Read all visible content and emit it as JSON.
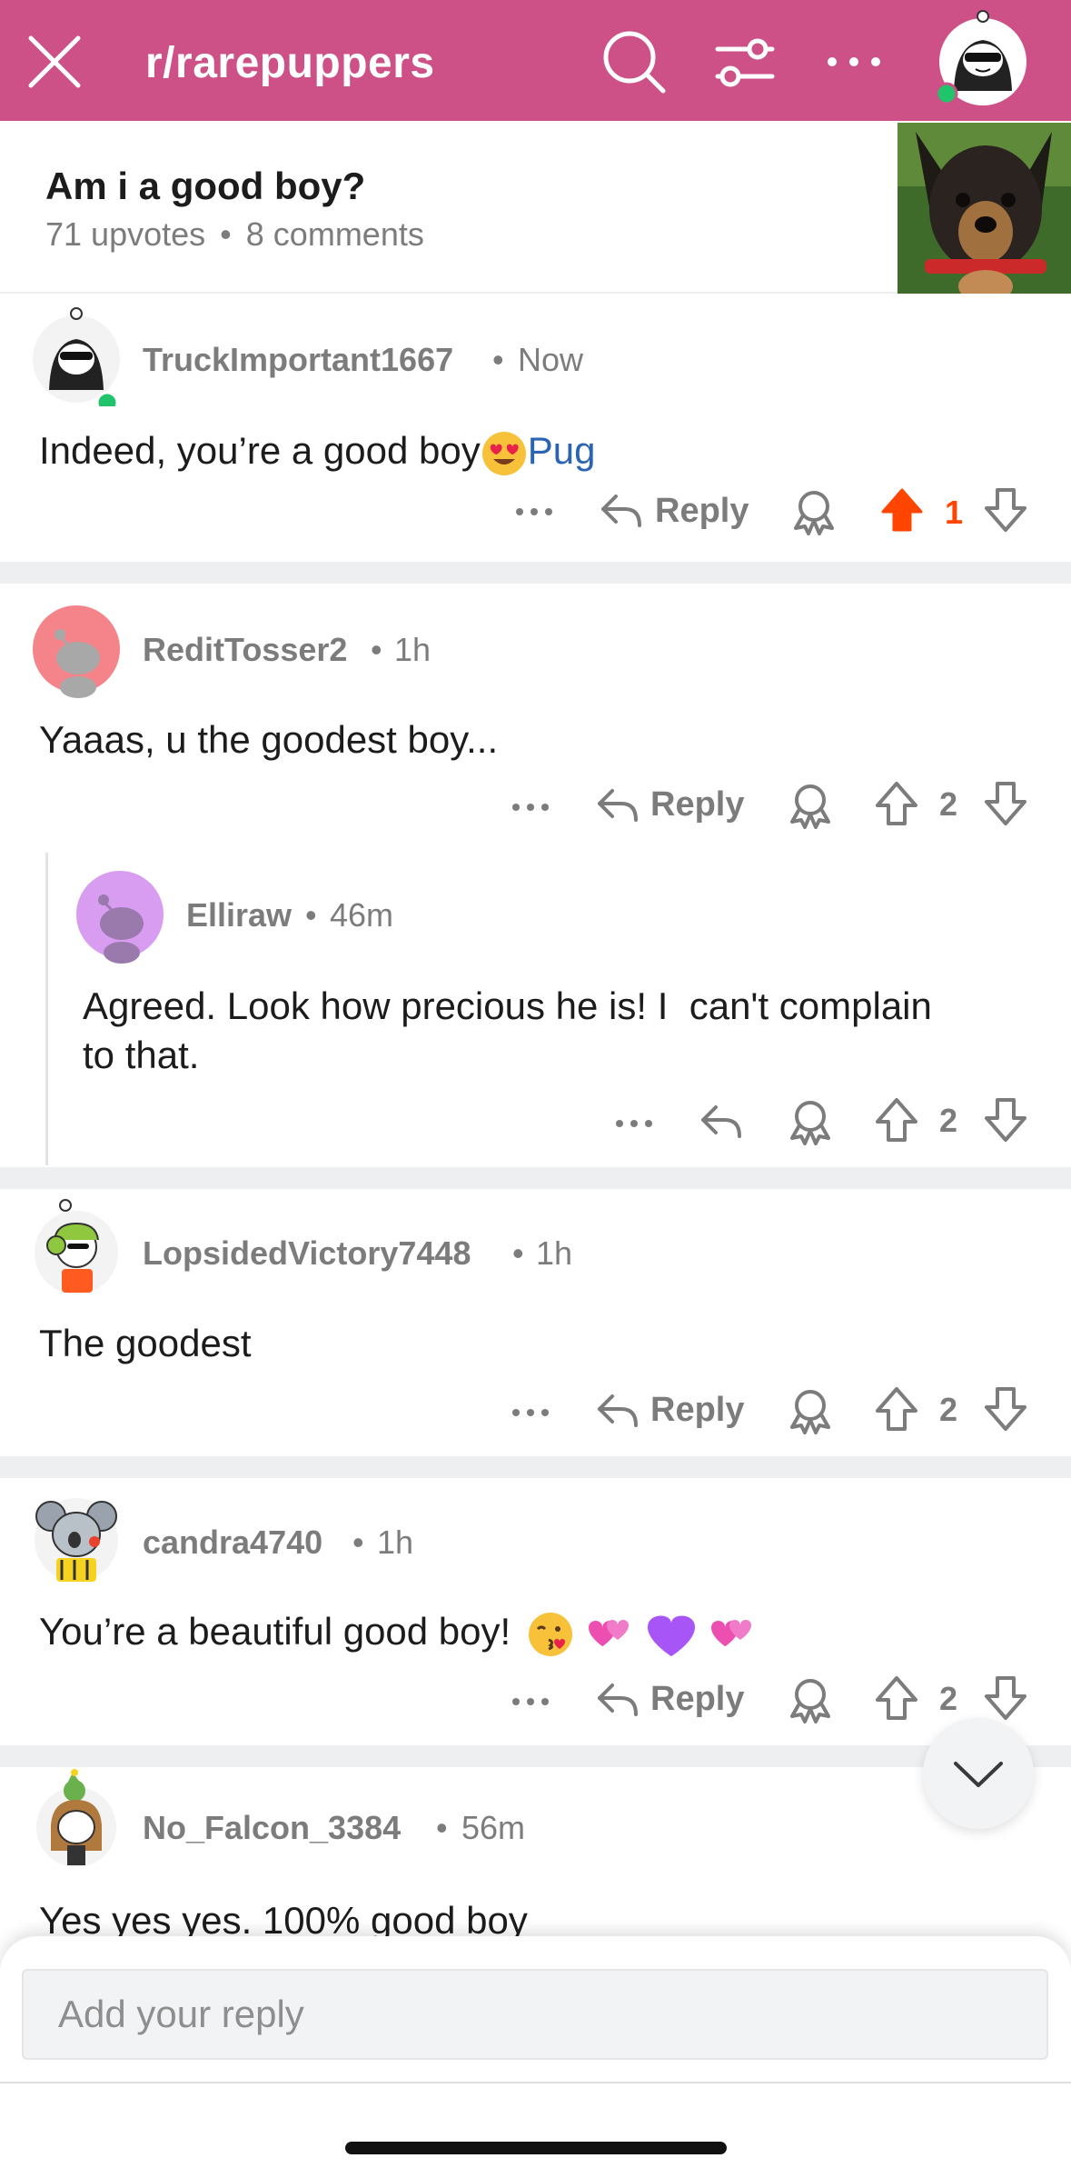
{
  "header": {
    "subreddit": "r/rarepuppers",
    "close_icon": "close-icon",
    "search_icon": "search-icon",
    "filter_icon": "sort-filter-icon",
    "more_icon": "more-icon",
    "brand_color": "#cd5086"
  },
  "post": {
    "title": "Am i a good boy?",
    "upvotes": "71 upvotes",
    "sep": "•",
    "comments": "8 comments"
  },
  "actions": {
    "reply_label": "Reply",
    "dot": "•"
  },
  "comments": [
    {
      "author": "TruckImportant1667",
      "time": "Now",
      "body": "Indeed, you’re a good boy",
      "link": "Pug",
      "votes": "1",
      "upvoted": true
    },
    {
      "author": "ReditTosser2",
      "time": "1h",
      "body": "Yaaas, u the goodest boy...",
      "votes": "2"
    },
    {
      "author": "Elliraw",
      "time": "46m",
      "body_line1": "Agreed. Look how precious he is! I  can't complain",
      "body_line2": "to that.",
      "votes": "2"
    },
    {
      "author": "LopsidedVictory7448",
      "time": "1h",
      "body": "The goodest",
      "votes": "2"
    },
    {
      "author": "candra4740",
      "time": "1h",
      "body": "You’re a beautiful good boy!",
      "votes": "2"
    },
    {
      "author": "No_Falcon_3384",
      "time": "56m",
      "body": "Yes yes yes. 100% good boy"
    }
  ],
  "composer": {
    "placeholder": "Add your reply"
  },
  "colors": {
    "upvote_active": "#ff4500",
    "link": "#2a64b3",
    "meta_gray": "#7c7c7c"
  }
}
